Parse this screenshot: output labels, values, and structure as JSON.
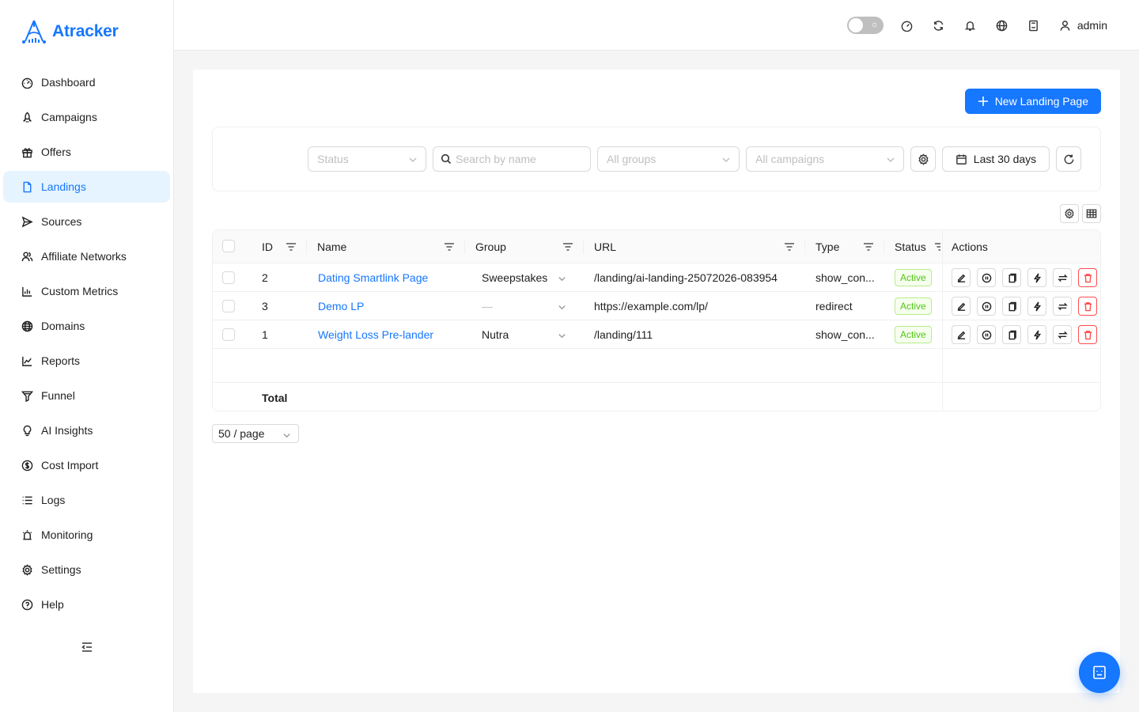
{
  "app": {
    "name": "Atracker"
  },
  "sidebar": {
    "items": [
      {
        "label": "Dashboard",
        "icon": "dashboard-icon"
      },
      {
        "label": "Campaigns",
        "icon": "rocket-icon"
      },
      {
        "label": "Offers",
        "icon": "gift-icon"
      },
      {
        "label": "Landings",
        "icon": "file-icon",
        "active": true
      },
      {
        "label": "Sources",
        "icon": "send-icon"
      },
      {
        "label": "Affiliate Networks",
        "icon": "team-icon"
      },
      {
        "label": "Custom Metrics",
        "icon": "bar-chart-icon"
      },
      {
        "label": "Domains",
        "icon": "globe-icon"
      },
      {
        "label": "Reports",
        "icon": "line-chart-icon"
      },
      {
        "label": "Funnel",
        "icon": "funnel-icon"
      },
      {
        "label": "AI Insights",
        "icon": "bulb-icon"
      },
      {
        "label": "Cost Import",
        "icon": "dollar-icon"
      },
      {
        "label": "Logs",
        "icon": "list-icon"
      },
      {
        "label": "Monitoring",
        "icon": "alert-icon"
      },
      {
        "label": "Settings",
        "icon": "gear-icon"
      },
      {
        "label": "Help",
        "icon": "question-icon"
      }
    ]
  },
  "header": {
    "user": "admin"
  },
  "toolbar": {
    "new_label": "New Landing Page"
  },
  "filters": {
    "status_placeholder": "Status",
    "search_placeholder": "Search by name",
    "groups_placeholder": "All groups",
    "campaigns_placeholder": "All campaigns",
    "date_label": "Last 30 days"
  },
  "table": {
    "columns": [
      "ID",
      "Name",
      "Group",
      "URL",
      "Type",
      "Status",
      "Actions"
    ],
    "rows": [
      {
        "id": "2",
        "name": "Dating Smartlink Page",
        "group": "Sweepstakes",
        "url": "/landing/ai-landing-25072026-083954",
        "type": "show_con...",
        "status": "Active"
      },
      {
        "id": "3",
        "name": "Demo LP",
        "group": "—",
        "url": "https://example.com/lp/",
        "type": "redirect",
        "status": "Active"
      },
      {
        "id": "1",
        "name": "Weight Loss Pre-lander",
        "group": "Nutra",
        "url": "/landing/111",
        "type": "show_con...",
        "status": "Active"
      }
    ],
    "total_label": "Total"
  },
  "pagination": {
    "page_size": "50 / page"
  },
  "colors": {
    "primary": "#1677ff",
    "active_tag": "#52c41a",
    "danger": "#ff4d4f"
  }
}
